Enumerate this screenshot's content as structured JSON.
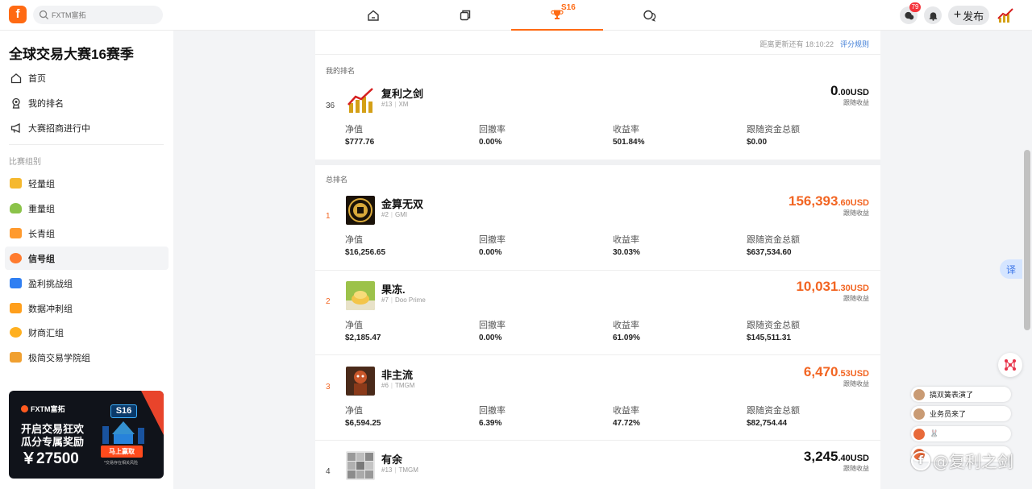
{
  "header": {
    "logo_text": "f",
    "search_placeholder": "FXTM富拓",
    "competition_tab_tag": "S16",
    "notification_count": "79",
    "publish_label": "发布"
  },
  "sidebar": {
    "title": "全球交易大赛16赛季",
    "items": [
      {
        "label": "首页",
        "icon": "home-icon"
      },
      {
        "label": "我的排名",
        "icon": "ranking-icon"
      },
      {
        "label": "大赛招商进行中",
        "icon": "megaphone-icon"
      }
    ],
    "section_label": "比赛组别",
    "groups": [
      {
        "label": "轻量组",
        "color": "#f5b82e"
      },
      {
        "label": "重量组",
        "color": "#8bc34a"
      },
      {
        "label": "长青组",
        "color": "#ff9a2e"
      },
      {
        "label": "信号组",
        "color": "#ff7b2e"
      },
      {
        "label": "盈利挑战组",
        "color": "#2f7ff2"
      },
      {
        "label": "数据冲刺组",
        "color": "#ff9f1c"
      },
      {
        "label": "财商汇组",
        "color": "#ffb020"
      },
      {
        "label": "极简交易学院组",
        "color": "#f0a030"
      }
    ],
    "active_group": "信号组",
    "banner": {
      "brand": "FXTM富拓",
      "line1": "开启交易狂欢",
      "line2": "瓜分专属奖励",
      "amount": "￥27500",
      "tag": "S16",
      "cta": "马上赢取",
      "note": "*交易存在相关风险"
    }
  },
  "main": {
    "update_text": "距离更新还有 18:10:22",
    "rules_link": "评分规则",
    "my_rank_label": "我的排名",
    "total_rank_label": "总排名",
    "stat_labels": {
      "net": "净值",
      "drawdown": "回撤率",
      "return": "收益率",
      "follow": "跟随资金总额"
    },
    "amount_caption": "跟随收益",
    "currency": "USD",
    "my_entry": {
      "rank": "36",
      "name": "复利之剑",
      "id": "#13",
      "broker": "XM",
      "amount_int": "0",
      "amount_dec": ".00",
      "net": "$777.76",
      "drawdown": "0.00%",
      "return": "501.84%",
      "follow": "$0.00"
    },
    "rankings": [
      {
        "rank": "1",
        "name": "金算无双",
        "id": "#2",
        "broker": "GMI",
        "amount_int": "156,393",
        "amount_dec": ".60",
        "net": "$16,256.65",
        "drawdown": "0.00%",
        "return": "30.03%",
        "follow": "$637,534.60"
      },
      {
        "rank": "2",
        "name": "果冻.",
        "id": "#7",
        "broker": "Doo Prime",
        "amount_int": "10,031",
        "amount_dec": ".30",
        "net": "$2,185.47",
        "drawdown": "0.00%",
        "return": "61.09%",
        "follow": "$145,511.31"
      },
      {
        "rank": "3",
        "name": "非主流",
        "id": "#6",
        "broker": "TMGM",
        "amount_int": "6,470",
        "amount_dec": ".53",
        "net": "$6,594.25",
        "drawdown": "6.39%",
        "return": "47.72%",
        "follow": "$82,754.44"
      },
      {
        "rank": "4",
        "name": "有余",
        "id": "#13",
        "broker": "TMGM",
        "amount_int": "3,245",
        "amount_dec": ".40"
      }
    ]
  },
  "floating": {
    "translate_label": "译",
    "danmu": [
      "搞双簧表演了",
      "业务员来了",
      "🐰"
    ],
    "watermark": "@复利之剑"
  },
  "colors": {
    "accent": "#ff6a13",
    "hot_amount": "#f26522",
    "link": "#3c7bd6"
  }
}
